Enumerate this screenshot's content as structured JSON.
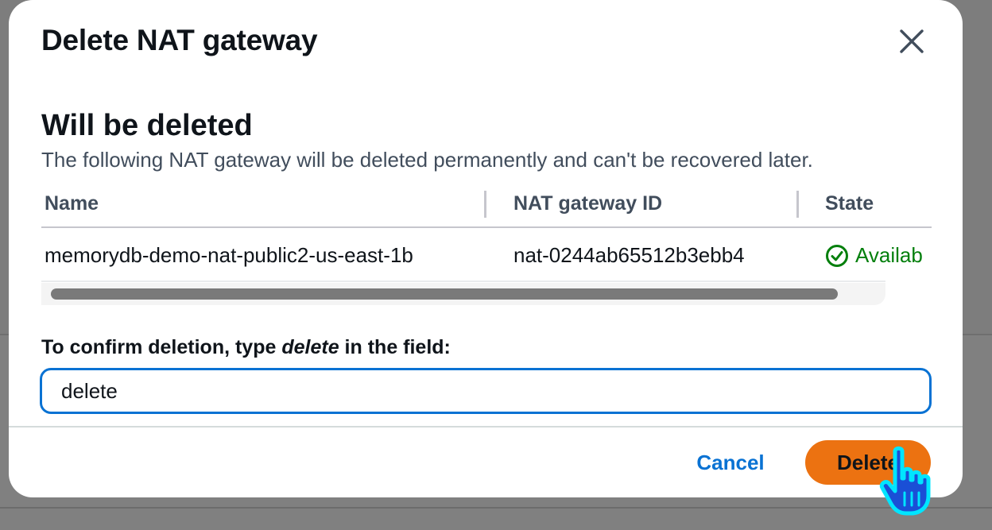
{
  "modal": {
    "title": "Delete NAT gateway",
    "close_icon": "close-icon"
  },
  "section": {
    "title": "Will be deleted",
    "description": "The following NAT gateway will be deleted permanently and can't be recovered later."
  },
  "table": {
    "columns": [
      "Name",
      "NAT gateway ID",
      "State"
    ],
    "rows": [
      {
        "name": "memorydb-demo-nat-public2-us-east-1b",
        "id": "nat-0244ab65512b3ebb4",
        "state": "Availab",
        "state_icon": "check-circle-icon"
      }
    ]
  },
  "confirm": {
    "label_prefix": "To confirm deletion, type ",
    "label_keyword": "delete",
    "label_suffix": " in the field:",
    "value": "delete"
  },
  "footer": {
    "cancel_label": "Cancel",
    "delete_label": "Delete"
  },
  "colors": {
    "accent": "#0972d3",
    "danger_button": "#ec7211",
    "success": "#037f0c"
  }
}
